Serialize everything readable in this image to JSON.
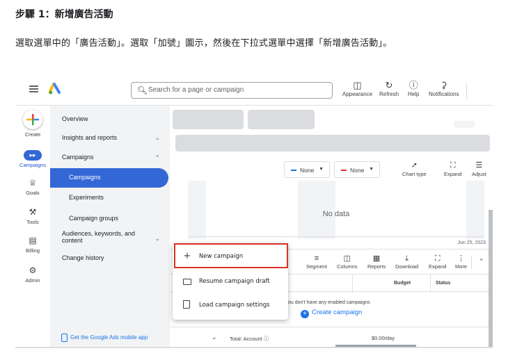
{
  "doc": {
    "step_title": "步驟 1：新增廣告活動",
    "instruction": "選取選單中的「廣告活動」。選取「加號」圖示，然後在下拉式選單中選擇「新增廣告活動」。"
  },
  "topbar": {
    "search_placeholder": "Search for a page or campaign",
    "tools": [
      {
        "label": "Appearance",
        "icon": "appearance-icon"
      },
      {
        "label": "Refresh",
        "icon": "refresh-icon"
      },
      {
        "label": "Help",
        "icon": "help-icon"
      },
      {
        "label": "Notifications",
        "icon": "bell-icon"
      }
    ]
  },
  "rail": {
    "items": [
      {
        "label": "Create",
        "icon": "plus-icon"
      },
      {
        "label": "Campaigns",
        "icon": "megaphone-icon"
      },
      {
        "label": "Goals",
        "icon": "trophy-icon"
      },
      {
        "label": "Tools",
        "icon": "tools-icon"
      },
      {
        "label": "Billing",
        "icon": "card-icon"
      },
      {
        "label": "Admin",
        "icon": "gear-icon"
      }
    ]
  },
  "nav": {
    "overview": "Overview",
    "insights": "Insights and reports",
    "campaigns_group": "Campaigns",
    "campaigns": "Campaigns",
    "experiments": "Experiments",
    "campaign_groups": "Campaign groups",
    "audiences_line1": "Audiences, keywords, and",
    "audiences_line2": "content",
    "change_history": "Change history",
    "mobile_app": "Get the Google Ads mobile app"
  },
  "chart": {
    "filter1": "None",
    "filter2": "None",
    "filter1_color": "#1a73e8",
    "filter2_color": "#d93025",
    "tools": [
      "Chart type",
      "Expand",
      "Adjust"
    ],
    "no_data": "No data",
    "end_date": "Jun 25, 2023"
  },
  "table": {
    "tools": [
      "Segment",
      "Columns",
      "Reports",
      "Download",
      "Expand",
      "More"
    ],
    "headers": {
      "budget": "Budget",
      "status": "Status"
    },
    "empty_message": "You don't have any enabled campaigns",
    "create_campaign": "Create campaign",
    "total_label": "Total: Account",
    "total_amount": "$0.00/day"
  },
  "popup": {
    "items": [
      "New campaign",
      "Resume campaign draft",
      "Load campaign settings"
    ]
  },
  "colors": {
    "accent": "#3367d6",
    "highlight": "#d93025"
  }
}
